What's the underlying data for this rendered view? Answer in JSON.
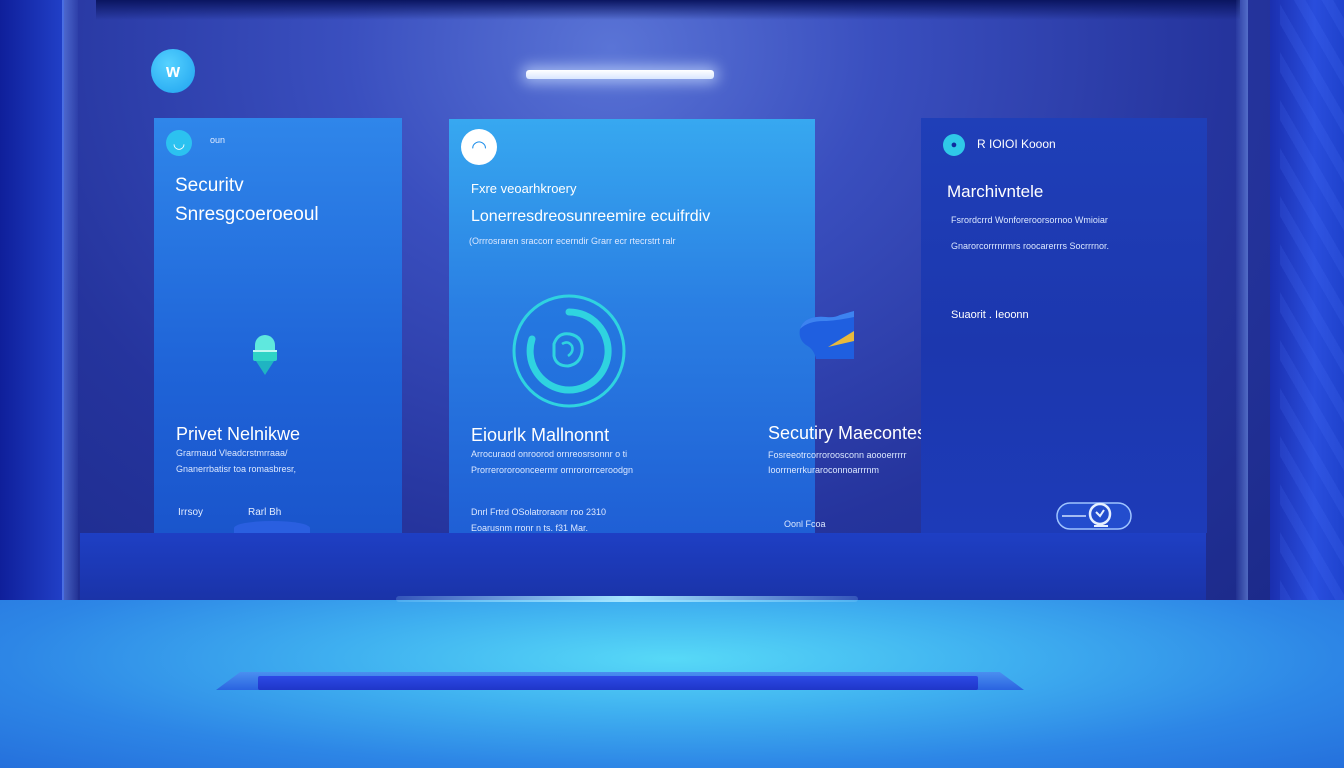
{
  "app": {
    "logo_glyph": "w"
  },
  "cards": {
    "left": {
      "tag": "oun",
      "title_line1": "Securitv",
      "title_line2": "Snresgcoeroeoul",
      "heading": "Privet Nelnikwe",
      "desc_line1": "Grarmaud Vleadcrstmrraaa/",
      "desc_line2": "Gnanerrbatisr toa romasbresr,",
      "footer_a": "Irrsoy",
      "footer_b": "Rarl Bh"
    },
    "center": {
      "kicker": "Fxre veoarhkroery",
      "title": "Lonerresdreosunreemire ecuifrdiv",
      "subtitle": "(Orrrosraren sraccorr ecerndir Grarr ecr rtecrstrt ralr",
      "heading": "Eiourlk Mallnonnt",
      "desc_line1": "Arrocuraod onroorod ornreosrsonnr o ti",
      "desc_line2": "Prorrerororoonceermr ornrororrceroodgn",
      "footer_line1": "Dnrl Frtrd OSolatroraonr roo 2310",
      "footer_line2": "Eoarusnm rronr n ts. f31 Mar."
    },
    "middle_right": {
      "heading": "Secutiry Maecontes",
      "desc_line1": "Fosreeotrcorroroosconn aoooerrrrr",
      "desc_line2": "Ioorrnerrkuraroconnoarrrnm",
      "footer": "Oonl Fcoa"
    },
    "right": {
      "tag": "R IOIOI Kooon",
      "heading": "Marchivntele",
      "desc_line1": "Fsrordcrrd Wonforeroorsornoo Wmioiar",
      "desc_line2": "Gnarorcorrrnrmrs roocarerrrs Socrrrnor.",
      "label": "Suaorit . Ieoonn"
    }
  },
  "colors": {
    "accent_cyan": "#2fd3e0",
    "panel_blue": "#2a7fe3",
    "panel_dark": "#1f3fb8"
  }
}
